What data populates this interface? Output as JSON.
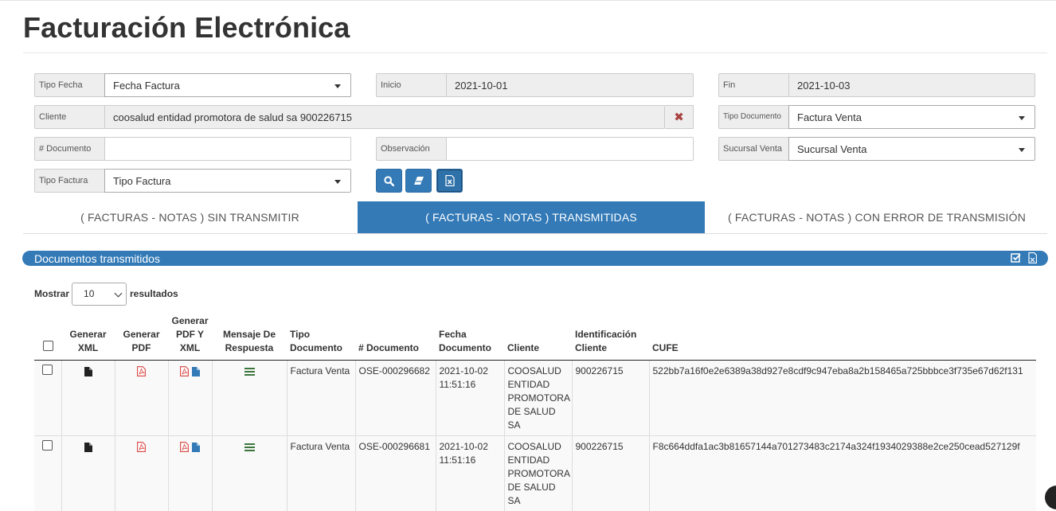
{
  "page": {
    "title": "Facturación Electrónica"
  },
  "filters": {
    "tipo_fecha": {
      "label": "Tipo Fecha",
      "value": "Fecha Factura"
    },
    "inicio": {
      "label": "Inicio",
      "value": "2021-10-01"
    },
    "fin": {
      "label": "Fin",
      "value": "2021-10-03"
    },
    "cliente": {
      "label": "Cliente",
      "value": "coosalud entidad promotora de salud sa 900226715"
    },
    "tipo_documento": {
      "label": "Tipo Documento",
      "value": "Factura Venta"
    },
    "num_documento": {
      "label": "# Documento",
      "value": ""
    },
    "observacion": {
      "label": "Observación",
      "value": ""
    },
    "sucursal_venta": {
      "label": "Sucursal Venta",
      "value": "Sucursal Venta"
    },
    "tipo_factura": {
      "label": "Tipo Factura",
      "value": "Tipo Factura"
    }
  },
  "actions": {
    "search_icon": "search-icon",
    "eraser_icon": "eraser-icon",
    "excel_icon": "excel-file-icon"
  },
  "tabs": [
    {
      "label": "( FACTURAS - NOTAS ) SIN TRANSMITIR",
      "active": false
    },
    {
      "label": "( FACTURAS - NOTAS ) TRANSMITIDAS",
      "active": true
    },
    {
      "label": "( FACTURAS - NOTAS ) CON ERROR DE TRANSMISIÓN",
      "active": false
    }
  ],
  "panel": {
    "title": "Documentos transmitidos",
    "tools": [
      "check-square-icon",
      "excel-export-icon"
    ]
  },
  "table_length": {
    "prefix": "Mostrar",
    "value": "10",
    "suffix": "resultados"
  },
  "table": {
    "headers": [
      "",
      "Generar XML",
      "Generar PDF",
      "Generar PDF Y XML",
      "Mensaje De Respuesta",
      "Tipo Documento",
      "# Documento",
      "Fecha Documento",
      "Cliente",
      "Identificación Cliente",
      "CUFE"
    ],
    "rows": [
      {
        "tipo_documento": "Factura Venta",
        "documento": "OSE-000296682",
        "fecha": "2021-10-02 11:51:16",
        "cliente": "COOSALUD ENTIDAD PROMOTORA DE SALUD SA",
        "identificacion": "900226715",
        "cufe": "522bb7a16f0e2e6389a38d927e8cdf9c947eba8a2b158465a725bbbce3f735e67d62f131"
      },
      {
        "tipo_documento": "Factura Venta",
        "documento": "OSE-000296681",
        "fecha": "2021-10-02 11:51:16",
        "cliente": "COOSALUD ENTIDAD PROMOTORA DE SALUD SA",
        "identificacion": "900226715",
        "cufe": "F8c664ddfa1ac3b81657144a701273483c2174a324f1934029388e2ce250cead527129f"
      }
    ]
  },
  "colors": {
    "primary": "#337ab7",
    "link_red": "#a94442",
    "pdf_red": "#d9534f",
    "file_blue": "#337ab7",
    "message_green": "#3c763d"
  }
}
